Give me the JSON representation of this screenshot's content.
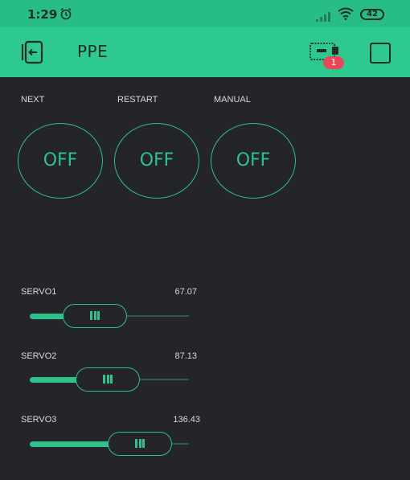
{
  "status_bar": {
    "time": "1:29",
    "battery": "42"
  },
  "app_bar": {
    "title": "PPE",
    "notification_count": "1"
  },
  "buttons": [
    {
      "label": "NEXT",
      "state": "OFF"
    },
    {
      "label": "RESTART",
      "state": "OFF"
    },
    {
      "label": "MANUAL",
      "state": "OFF"
    }
  ],
  "sliders": [
    {
      "label": "SERVO1",
      "value": "67.07"
    },
    {
      "label": "SERVO2",
      "value": "87.13"
    },
    {
      "label": "SERVO3",
      "value": "136.43"
    }
  ],
  "colors": {
    "accent": "#2fc08b",
    "background": "#23252a",
    "app_bar": "#2ec98e",
    "badge": "#e8475b"
  }
}
